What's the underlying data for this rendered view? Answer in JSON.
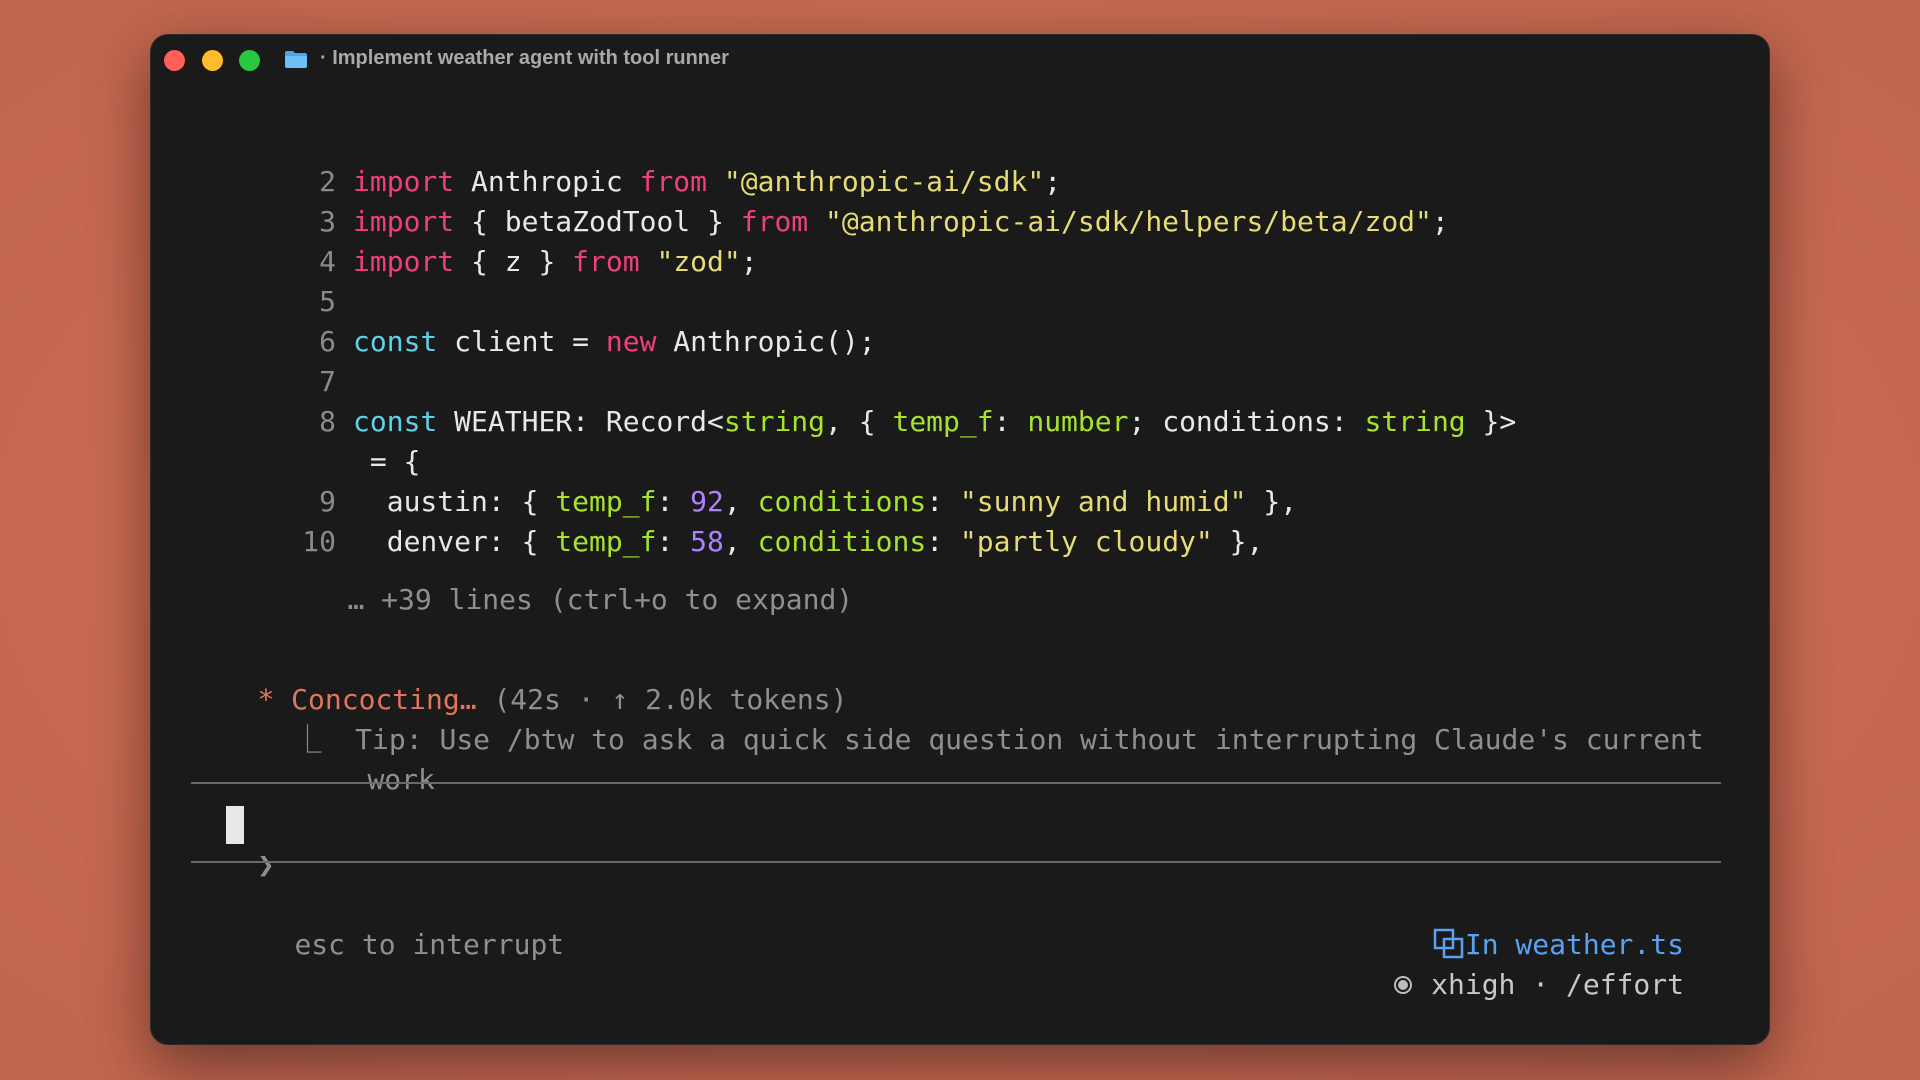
{
  "window": {
    "title": "· Implement weather agent with tool runner",
    "icon": "folder-icon"
  },
  "code_lines": [
    {
      "num": "2",
      "tokens": [
        {
          "t": "import",
          "c": "kw"
        },
        {
          "t": " Anthropic ",
          "c": "plain"
        },
        {
          "t": "from",
          "c": "kw"
        },
        {
          "t": " ",
          "c": "plain"
        },
        {
          "t": "\"@anthropic-ai/sdk\"",
          "c": "str"
        },
        {
          "t": ";",
          "c": "plain"
        }
      ]
    },
    {
      "num": "3",
      "tokens": [
        {
          "t": "import",
          "c": "kw"
        },
        {
          "t": " { betaZodTool } ",
          "c": "plain"
        },
        {
          "t": "from",
          "c": "kw"
        },
        {
          "t": " ",
          "c": "plain"
        },
        {
          "t": "\"@anthropic-ai/sdk/helpers/beta/zod\"",
          "c": "str"
        },
        {
          "t": ";",
          "c": "plain"
        }
      ]
    },
    {
      "num": "4",
      "tokens": [
        {
          "t": "import",
          "c": "kw"
        },
        {
          "t": " { z } ",
          "c": "plain"
        },
        {
          "t": "from",
          "c": "kw"
        },
        {
          "t": " ",
          "c": "plain"
        },
        {
          "t": "\"zod\"",
          "c": "str"
        },
        {
          "t": ";",
          "c": "plain"
        }
      ]
    },
    {
      "num": "5",
      "tokens": []
    },
    {
      "num": "6",
      "tokens": [
        {
          "t": "const",
          "c": "cst"
        },
        {
          "t": " client = ",
          "c": "plain"
        },
        {
          "t": "new",
          "c": "kw"
        },
        {
          "t": " Anthropic();",
          "c": "plain"
        }
      ]
    },
    {
      "num": "7",
      "tokens": []
    },
    {
      "num": "8",
      "tokens": [
        {
          "t": "const",
          "c": "cst"
        },
        {
          "t": " WEATHER: Record<",
          "c": "plain"
        },
        {
          "t": "string",
          "c": "typ"
        },
        {
          "t": ", { ",
          "c": "plain"
        },
        {
          "t": "temp_f",
          "c": "typ"
        },
        {
          "t": ": ",
          "c": "plain"
        },
        {
          "t": "number",
          "c": "typ"
        },
        {
          "t": "; conditions: ",
          "c": "plain"
        },
        {
          "t": "string",
          "c": "typ"
        },
        {
          "t": " }>",
          "c": "plain"
        }
      ]
    },
    {
      "num": "",
      "tokens": [
        {
          "t": " = {",
          "c": "plain"
        }
      ]
    },
    {
      "num": "9",
      "tokens": [
        {
          "t": "  austin: { ",
          "c": "plain"
        },
        {
          "t": "temp_f",
          "c": "typ"
        },
        {
          "t": ": ",
          "c": "plain"
        },
        {
          "t": "92",
          "c": "num"
        },
        {
          "t": ", ",
          "c": "plain"
        },
        {
          "t": "conditions",
          "c": "typ"
        },
        {
          "t": ": ",
          "c": "plain"
        },
        {
          "t": "\"sunny and humid\"",
          "c": "str"
        },
        {
          "t": " },",
          "c": "plain"
        }
      ]
    },
    {
      "num": "10",
      "tokens": [
        {
          "t": "  denver: { ",
          "c": "plain"
        },
        {
          "t": "temp_f",
          "c": "typ"
        },
        {
          "t": ": ",
          "c": "plain"
        },
        {
          "t": "58",
          "c": "num"
        },
        {
          "t": ", ",
          "c": "plain"
        },
        {
          "t": "conditions",
          "c": "typ"
        },
        {
          "t": ": ",
          "c": "plain"
        },
        {
          "t": "\"partly cloudy\"",
          "c": "str"
        },
        {
          "t": " },",
          "c": "plain"
        }
      ]
    }
  ],
  "collapsed_note": "… +39 lines (ctrl+o to expand)",
  "status": {
    "star": "*",
    "label": "Concocting…",
    "detail": "(42s · ↑ 2.0k tokens)",
    "tip_prefix": "⎿",
    "tip_line1": "Tip: Use /btw to ask a quick side question without interrupting Claude's current",
    "tip_line2": "work"
  },
  "prompt": {
    "symbol": "❯",
    "value": ""
  },
  "footer": {
    "hint": "esc to interrupt",
    "file_icon": "ide-file-icon",
    "file_label": "In weather.ts",
    "effort_icon": "effort-dot-icon",
    "effort_label": "xhigh · /effort"
  },
  "colors": {
    "keyword": "#f0407a",
    "const": "#5ed1e4",
    "string": "#e6db74",
    "type": "#a6e22e",
    "number": "#ae81ff",
    "accent": "#e0755c",
    "link": "#5aa2f0"
  }
}
